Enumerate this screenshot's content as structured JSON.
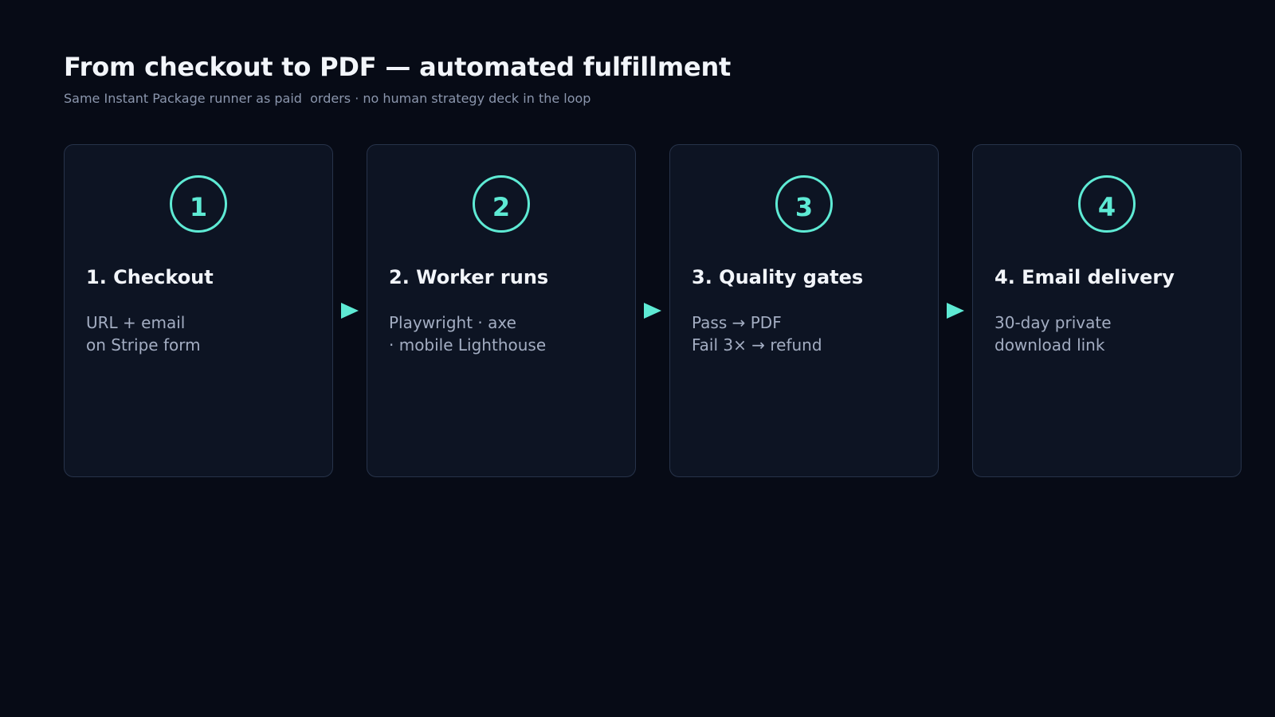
{
  "header": {
    "title": "From checkout to PDF — automated fulfillment",
    "subtitle": "Same Instant Package runner as paid  orders · no human strategy deck in the loop"
  },
  "colors": {
    "background": "#070b16",
    "card_background": "#0d1423",
    "card_border": "#27334a",
    "accent": "#5eead4",
    "title_text": "#f2f5fa",
    "body_text": "#a3adc2"
  },
  "steps": [
    {
      "number": "1",
      "title": "1. Checkout",
      "lines": [
        "URL + email",
        "on Stripe form"
      ]
    },
    {
      "number": "2",
      "title": "2. Worker runs",
      "lines": [
        "Playwright · axe",
        "· mobile Lighthouse"
      ]
    },
    {
      "number": "3",
      "title": "3. Quality gates",
      "lines": [
        "Pass → PDF",
        "Fail 3× → refund"
      ]
    },
    {
      "number": "4",
      "title": "4. Email delivery",
      "lines": [
        "30-day private",
        "download link"
      ]
    }
  ],
  "connectors": {
    "icon": "play-arrow-icon"
  }
}
